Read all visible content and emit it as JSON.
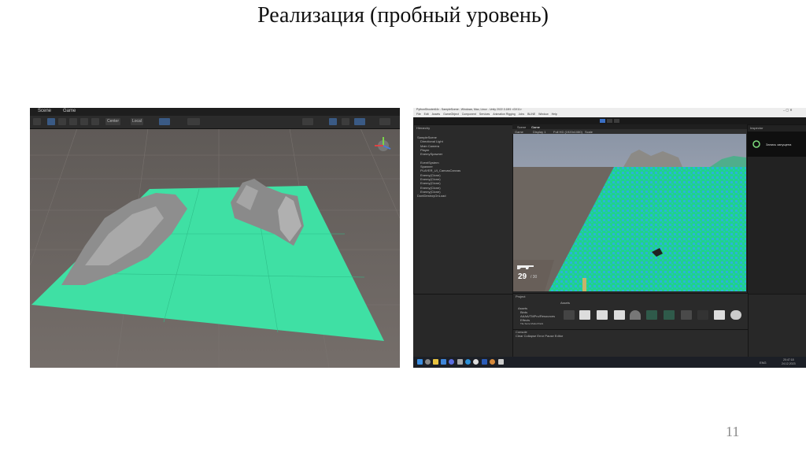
{
  "slide": {
    "title": "Реализация (пробный уровень)",
    "page_number": "11"
  },
  "scene_editor": {
    "tabs": [
      "Scene",
      "Game"
    ],
    "toolbar": {
      "pivot": "Center",
      "space": "Local"
    }
  },
  "unity_window": {
    "title": "PythonShooter64x - SampleScene - Windows, Mac, Linux - Unity 2022.3.18f1 <DX11>",
    "menu": [
      "File",
      "Edit",
      "Assets",
      "GameObject",
      "Component",
      "Services",
      "Animation Rigging",
      "Jobs",
      "BLINE",
      "Window",
      "Help"
    ],
    "hierarchy": {
      "label": "Hierarchy",
      "items": [
        "SampleScene",
        "Directional Light",
        "Main Camera",
        "Player",
        "EnemySpawner",
        "",
        "EventSystem",
        "Spawner",
        "PLAYER_UI_CanvasCanvas",
        "Enemy(Clone)",
        "Enemy(Clone)",
        "Enemy(Clone)",
        "Enemy(Clone)",
        "Enemy(Clone)",
        "DontDestroyOnLoad"
      ]
    },
    "view_tabs": [
      "Scene",
      "Game"
    ],
    "game_bar": {
      "display": "Game",
      "res": "Display 1",
      "aspect": "Full HD (1920x1080)",
      "scale": "Scale"
    },
    "inspector_label": "Inspector",
    "hud": {
      "ammo": "29",
      "ammo_max": "/ 30"
    },
    "notification": "Запись запущена",
    "project": {
      "label": "Project",
      "assets_label": "Assets",
      "tree": [
        "Assets",
        "Birds",
        "AAAA/TMPro/Resources",
        "Effects",
        "Tile Serie Model Pack"
      ]
    },
    "console": {
      "label": "Console",
      "controls": "Clear  Collapse  Error Pause  Editor"
    },
    "tray": {
      "lang": "ENG",
      "time": "20:47:18",
      "date": "24.12.2023"
    }
  }
}
